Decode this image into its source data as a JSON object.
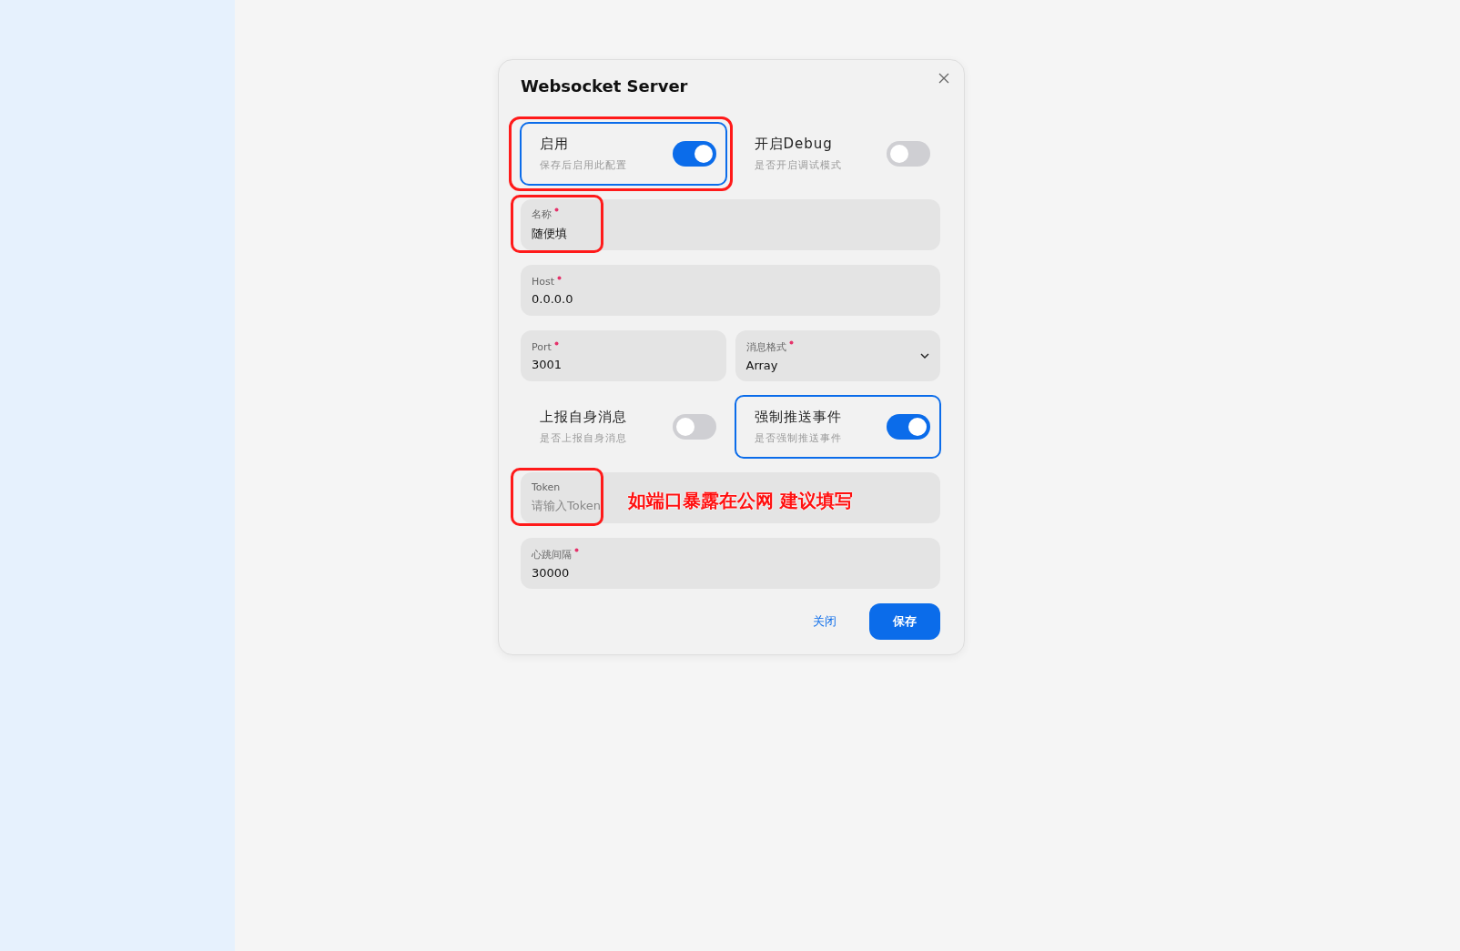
{
  "dialog": {
    "title": "Websocket Server",
    "rows": [
      [
        {
          "kind": "switch",
          "label": "启用",
          "description": "保存后启用此配置",
          "on": true,
          "focused": true,
          "annotated": true
        },
        {
          "kind": "switch",
          "label": "开启Debug",
          "description": "是否开启调试模式",
          "on": false,
          "focused": false,
          "annotated": false
        }
      ],
      [
        {
          "kind": "field",
          "label": "名称",
          "required": true,
          "value": "随便填",
          "annotated": true
        }
      ],
      [
        {
          "kind": "field",
          "label": "Host",
          "required": true,
          "value": "0.0.0.0",
          "annotated": false
        }
      ],
      [
        {
          "kind": "field",
          "label": "Port",
          "required": true,
          "value": "3001",
          "annotated": false
        },
        {
          "kind": "select",
          "label": "消息格式",
          "required": true,
          "value": "Array",
          "annotated": false
        }
      ],
      [
        {
          "kind": "switch",
          "label": "上报自身消息",
          "description": "是否上报自身消息",
          "on": false,
          "focused": false,
          "annotated": false
        },
        {
          "kind": "switch",
          "label": "强制推送事件",
          "description": "是否强制推送事件",
          "on": true,
          "focused": true,
          "annotated": false
        }
      ],
      [
        {
          "kind": "field",
          "label": "Token",
          "required": false,
          "placeholder": "请输入Token",
          "annotated": true,
          "note": "如端口暴露在公网 建议填写"
        }
      ],
      [
        {
          "kind": "field",
          "label": "心跳间隔",
          "required": true,
          "value": "30000",
          "annotated": false
        }
      ]
    ],
    "buttons": [
      {
        "kind": "text",
        "label": "关闭"
      },
      {
        "kind": "primary",
        "label": "保存"
      }
    ]
  }
}
